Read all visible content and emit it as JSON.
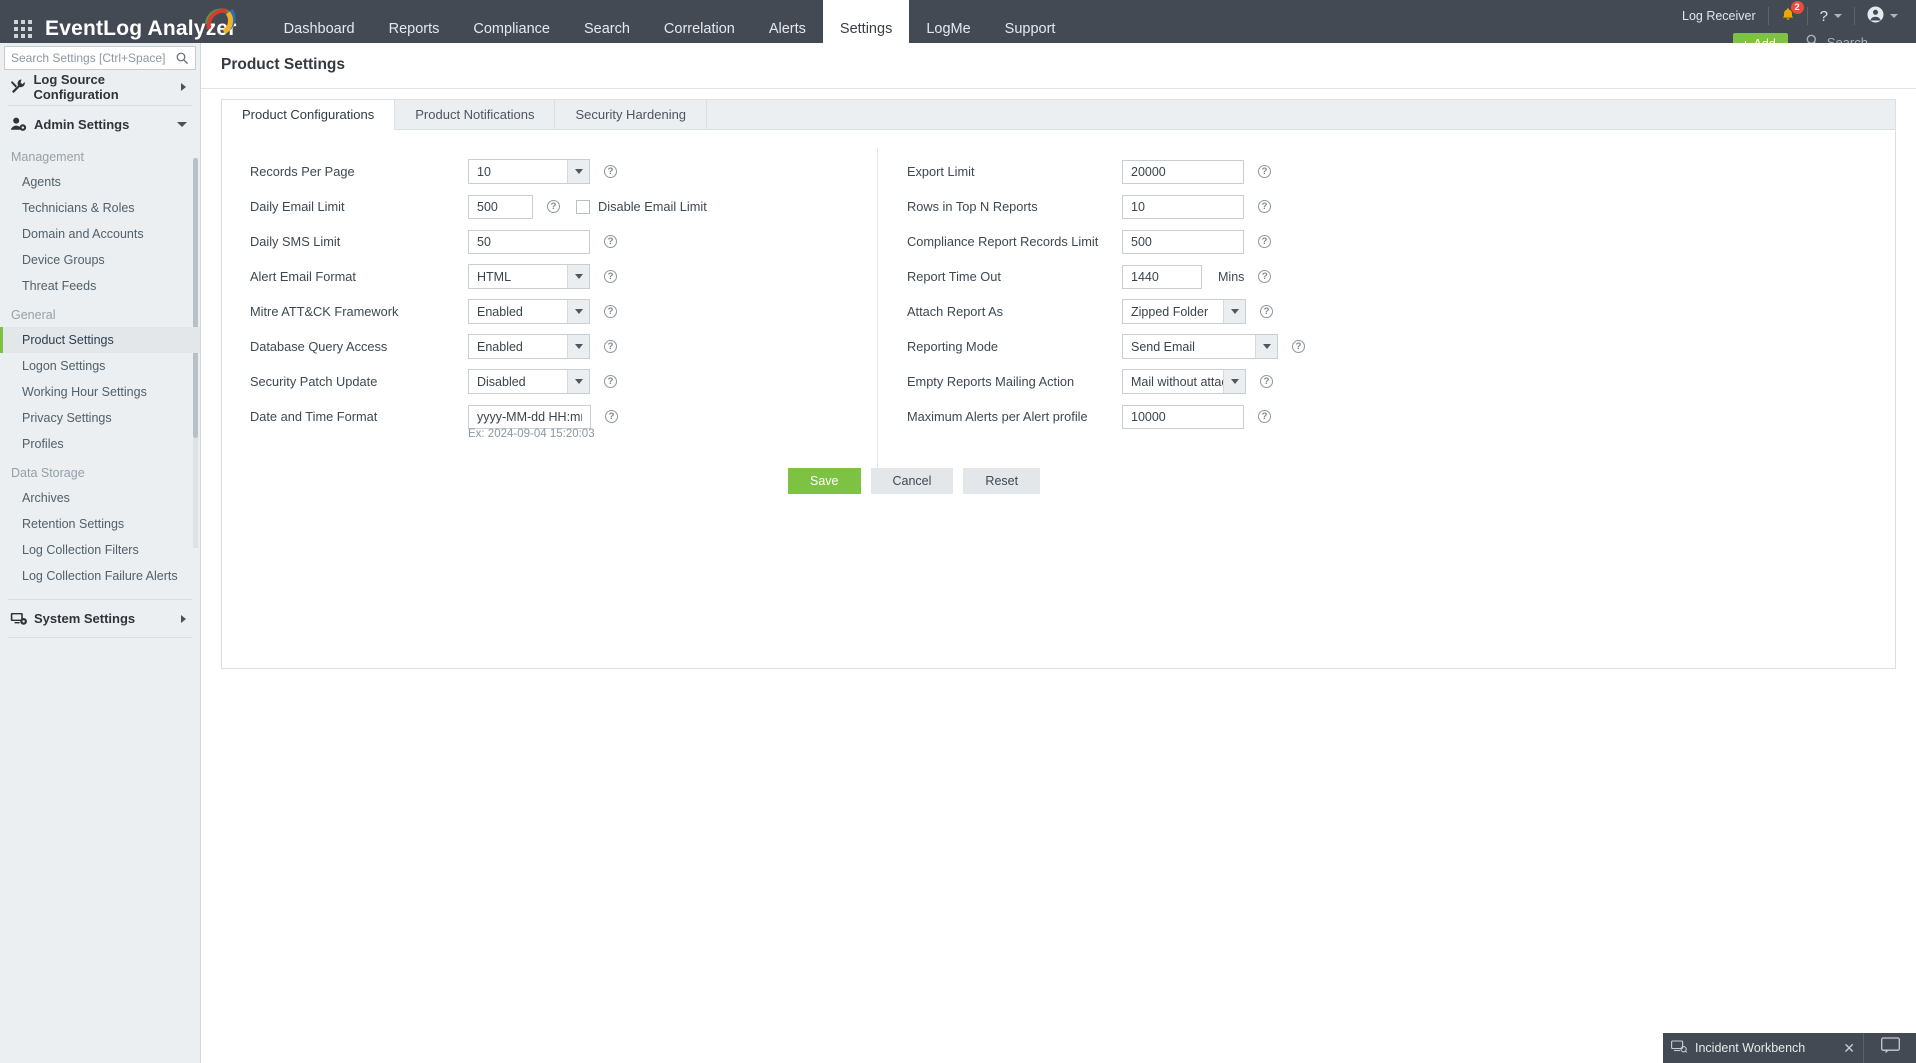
{
  "app": {
    "brand": "EventLog Analyzer",
    "page_title": "Product Settings",
    "accent_green": "#7dc242",
    "topbar_bg": "#434a54"
  },
  "topnav": {
    "items": [
      {
        "label": "Dashboard",
        "active": false
      },
      {
        "label": "Reports",
        "active": false
      },
      {
        "label": "Compliance",
        "active": false
      },
      {
        "label": "Search",
        "active": false
      },
      {
        "label": "Correlation",
        "active": false
      },
      {
        "label": "Alerts",
        "active": false
      },
      {
        "label": "Settings",
        "active": true
      },
      {
        "label": "LogMe",
        "active": false
      },
      {
        "label": "Support",
        "active": false
      }
    ]
  },
  "header_right": {
    "log_receiver": "Log Receiver",
    "notification_count": "2",
    "help_label": "?",
    "add_button": "Add",
    "add_icon": "plus-icon",
    "search_placeholder": "Search"
  },
  "sidebar": {
    "search_placeholder": "Search Settings [Ctrl+Space]",
    "groups": [
      {
        "label": "Log Source Configuration",
        "icon": "tools-icon",
        "expanded": false
      },
      {
        "label": "Admin Settings",
        "icon": "admin-user-icon",
        "expanded": true
      },
      {
        "label": "System Settings",
        "icon": "monitor-gear-icon",
        "expanded": false
      }
    ],
    "sections": [
      {
        "title": "Management",
        "items": [
          {
            "label": "Agents",
            "active": false
          },
          {
            "label": "Technicians & Roles",
            "active": false
          },
          {
            "label": "Domain and Accounts",
            "active": false
          },
          {
            "label": "Device Groups",
            "active": false
          },
          {
            "label": "Threat Feeds",
            "active": false
          }
        ]
      },
      {
        "title": "General",
        "items": [
          {
            "label": "Product Settings",
            "active": true
          },
          {
            "label": "Logon Settings",
            "active": false
          },
          {
            "label": "Working Hour Settings",
            "active": false
          },
          {
            "label": "Privacy Settings",
            "active": false
          },
          {
            "label": "Profiles",
            "active": false
          }
        ]
      },
      {
        "title": "Data Storage",
        "items": [
          {
            "label": "Archives",
            "active": false
          },
          {
            "label": "Retention Settings",
            "active": false
          },
          {
            "label": "Log Collection Filters",
            "active": false
          },
          {
            "label": "Log Collection Failure Alerts",
            "active": false
          }
        ]
      }
    ]
  },
  "tabs": [
    {
      "label": "Product Configurations",
      "active": true
    },
    {
      "label": "Product Notifications",
      "active": false
    },
    {
      "label": "Security Hardening",
      "active": false
    }
  ],
  "form": {
    "left": {
      "records_per_page": {
        "label": "Records Per Page",
        "value": "10",
        "type": "select"
      },
      "daily_email_limit": {
        "label": "Daily Email Limit",
        "value": "500",
        "type": "text"
      },
      "disable_email_limit": {
        "label": "Disable Email Limit",
        "checked": false
      },
      "daily_sms_limit": {
        "label": "Daily SMS Limit",
        "value": "50",
        "type": "text"
      },
      "alert_email_format": {
        "label": "Alert Email Format",
        "value": "HTML",
        "type": "select"
      },
      "mitre_attack": {
        "label": "Mitre ATT&CK Framework",
        "value": "Enabled",
        "type": "select"
      },
      "database_query_access": {
        "label": "Database Query Access",
        "value": "Enabled",
        "type": "select"
      },
      "security_patch_update": {
        "label": "Security Patch Update",
        "value": "Disabled",
        "type": "select"
      },
      "date_time_format": {
        "label": "Date and Time Format",
        "value": "yyyy-MM-dd HH:mm:ss",
        "type": "text"
      },
      "date_time_hint": "Ex: 2024-09-04 15:20:03"
    },
    "right": {
      "export_limit": {
        "label": "Export Limit",
        "value": "20000",
        "type": "text"
      },
      "rows_top_n": {
        "label": "Rows in Top N Reports",
        "value": "10",
        "type": "text"
      },
      "compliance_records_limit": {
        "label": "Compliance Report Records Limit",
        "value": "500",
        "type": "text"
      },
      "report_time_out": {
        "label": "Report Time Out",
        "value": "1440",
        "unit": "Mins",
        "type": "text"
      },
      "attach_report_as": {
        "label": "Attach Report As",
        "value": "Zipped Folder",
        "type": "select"
      },
      "reporting_mode": {
        "label": "Reporting Mode",
        "value": "Send Email",
        "type": "select"
      },
      "empty_reports_action": {
        "label": "Empty Reports Mailing Action",
        "value": "Mail without attach",
        "type": "select"
      },
      "max_alerts_per_profile": {
        "label": "Maximum Alerts per Alert profile",
        "value": "10000",
        "type": "text"
      }
    },
    "buttons": {
      "save": "Save",
      "cancel": "Cancel",
      "reset": "Reset"
    },
    "help_icon": "question-mark-icon"
  },
  "footer": {
    "workbench_label": "Incident Workbench",
    "workbench_icon": "workbench-icon",
    "close_icon": "close-icon",
    "chat_icon": "chat-icon"
  }
}
